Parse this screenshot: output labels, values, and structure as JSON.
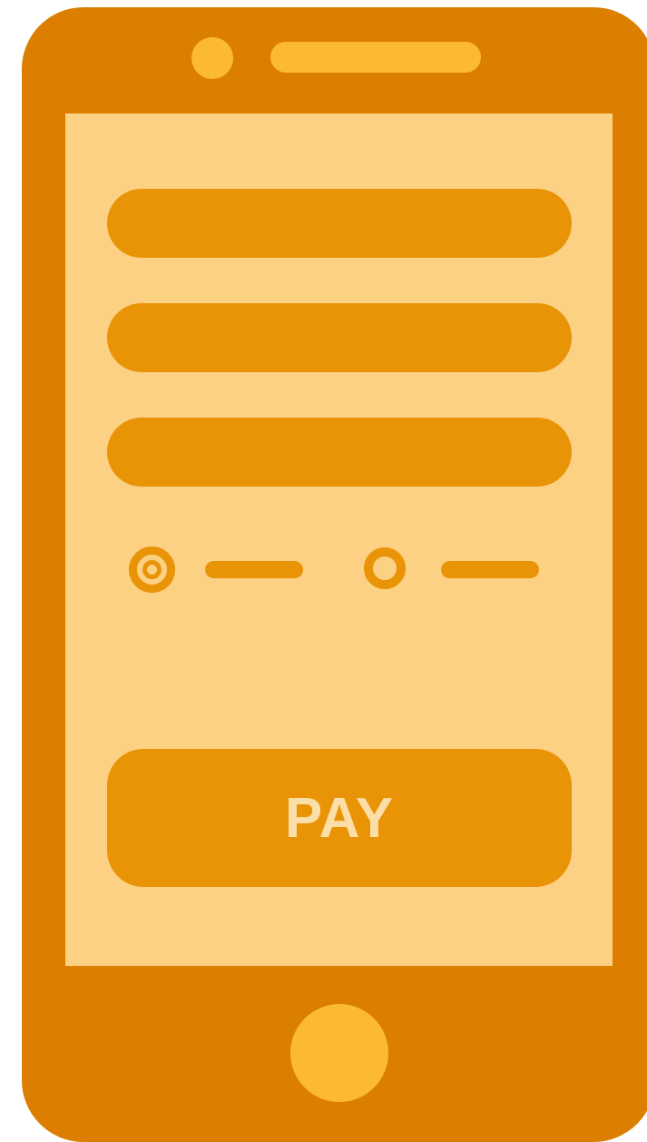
{
  "phone": {
    "form": {
      "fields": [
        {
          "value": "",
          "placeholder": ""
        },
        {
          "value": "",
          "placeholder": ""
        },
        {
          "value": "",
          "placeholder": ""
        }
      ],
      "payment_options": [
        {
          "selected": true
        },
        {
          "selected": false
        }
      ],
      "pay_label": "PAY"
    }
  },
  "colors": {
    "body": "#DC7E00",
    "accent": "#FBB934",
    "screen": "#FCD183",
    "control": "#E99307",
    "button_text": "#FCDFA8"
  }
}
